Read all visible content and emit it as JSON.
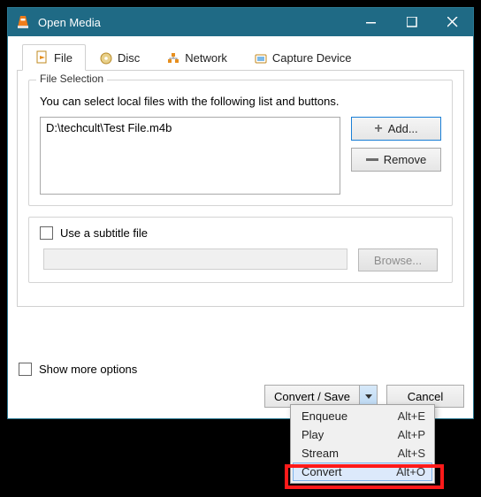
{
  "window": {
    "title": "Open Media"
  },
  "tabs": {
    "file": "File",
    "disc": "Disc",
    "network": "Network",
    "capture": "Capture Device"
  },
  "fileSelection": {
    "legend": "File Selection",
    "desc": "You can select local files with the following list and buttons.",
    "files": [
      "D:\\techcult\\Test File.m4b"
    ],
    "addLabel": "Add...",
    "removeLabel": "Remove"
  },
  "subtitle": {
    "label": "Use a subtitle file",
    "browse": "Browse..."
  },
  "showMore": "Show more options",
  "actions": {
    "convertSave": "Convert / Save",
    "cancel": "Cancel"
  },
  "menu": {
    "items": [
      {
        "label": "Enqueue",
        "shortcut": "Alt+E"
      },
      {
        "label": "Play",
        "shortcut": "Alt+P"
      },
      {
        "label": "Stream",
        "shortcut": "Alt+S"
      },
      {
        "label": "Convert",
        "shortcut": "Alt+O"
      }
    ]
  }
}
